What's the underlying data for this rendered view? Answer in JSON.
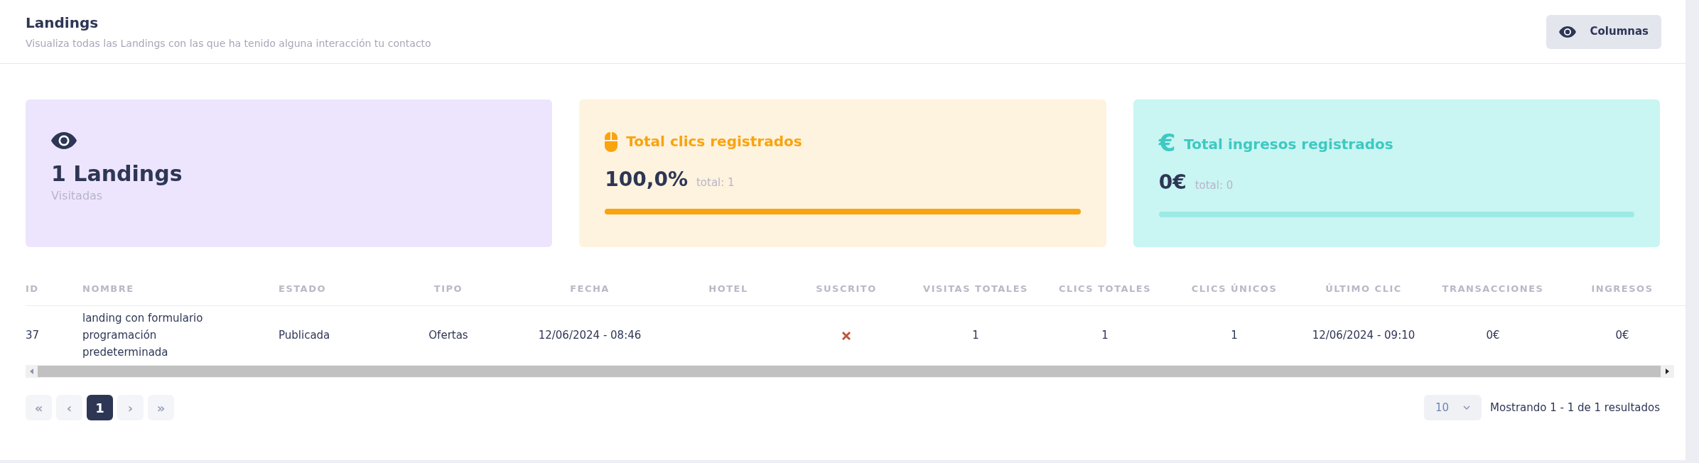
{
  "header": {
    "title": "Landings",
    "subtitle": "Visualiza todas las Landings con las que ha tenido alguna interacción tu contacto",
    "columns_button": "Columnas"
  },
  "cards": [
    {
      "kind": "visits",
      "value": "1 Landings",
      "caption": "Visitadas"
    },
    {
      "kind": "clicks",
      "title": "Total clics registrados",
      "value": "100,0%",
      "total": "total: 1",
      "level": 1
    },
    {
      "kind": "revenue",
      "icon": "€",
      "title": "Total ingresos registrados",
      "value": "0€",
      "total": "total: 0",
      "level": 0
    }
  ],
  "table": {
    "columns": [
      "ID",
      "NOMBRE",
      "ESTADO",
      "TIPO",
      "FECHA",
      "HOTEL",
      "SUSCRITO",
      "VISITAS TOTALES",
      "CLICS TOTALES",
      "CLICS ÚNICOS",
      "ÚLTIMO CLIC",
      "TRANSACCIONES",
      "INGRESOS"
    ],
    "rows": [
      {
        "id": "37",
        "nombre": "landing con formulario programación predeterminada",
        "estado": "Publicada",
        "tipo": "Ofertas",
        "fecha": "12/06/2024 - 08:46",
        "subscribed": false,
        "visitas": "1",
        "clics_totales": "1",
        "clics_unicos": "1",
        "ultimo_clic": "12/06/2024 - 09:10",
        "transacciones": "0€",
        "ingresos": "0€"
      }
    ]
  },
  "pagination": {
    "buttons": [
      {
        "label": "«",
        "disabled": true,
        "selected": false
      },
      {
        "label": "‹",
        "disabled": true,
        "selected": false
      },
      {
        "label": "1",
        "disabled": false,
        "selected": true
      },
      {
        "label": "›",
        "disabled": true,
        "selected": false
      },
      {
        "label": "»",
        "disabled": true,
        "selected": false
      }
    ],
    "page_size": "10",
    "summary": "Mostrando 1 - 1 de 1 resultados"
  }
}
